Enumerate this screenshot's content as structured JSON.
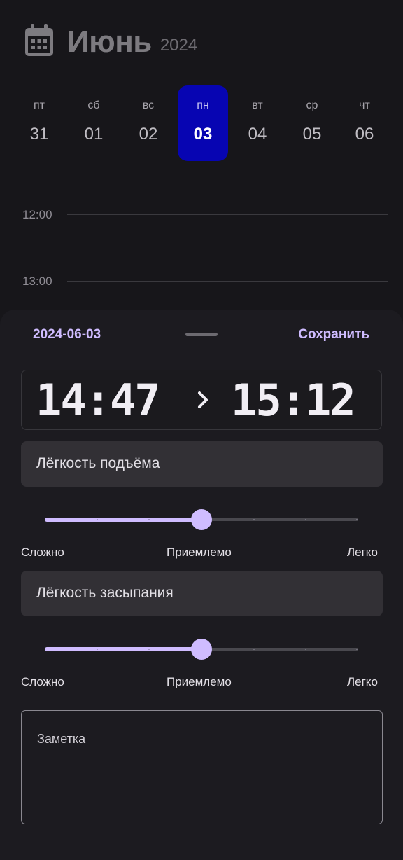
{
  "header": {
    "icon": "calendar-icon",
    "month": "Июнь",
    "year": "2024"
  },
  "week": {
    "days": [
      {
        "dow": "пт",
        "num": "31",
        "selected": false
      },
      {
        "dow": "сб",
        "num": "01",
        "selected": false
      },
      {
        "dow": "вс",
        "num": "02",
        "selected": false
      },
      {
        "dow": "пн",
        "num": "03",
        "selected": true
      },
      {
        "dow": "вт",
        "num": "04",
        "selected": false
      },
      {
        "dow": "ср",
        "num": "05",
        "selected": false
      },
      {
        "dow": "чт",
        "num": "06",
        "selected": false
      }
    ],
    "selected_color": "#0705b2"
  },
  "timeline": {
    "labels": [
      "12:00",
      "13:00"
    ]
  },
  "sheet": {
    "date": "2024-06-03",
    "save_label": "Сохранить",
    "start_time": "14:47",
    "end_time": "15:12",
    "arrow_icon": "chevron-right-icon",
    "accent_color": "#cfbcff",
    "wake": {
      "label": "Лёгкость подъёма",
      "value": 3,
      "max": 6,
      "min_label": "Сложно",
      "mid_label": "Приемлемо",
      "max_label": "Легко"
    },
    "sleep": {
      "label": "Лёгкость засыпания",
      "value": 3,
      "max": 6,
      "min_label": "Сложно",
      "mid_label": "Приемлемо",
      "max_label": "Легко"
    },
    "note_placeholder": "Заметка"
  }
}
